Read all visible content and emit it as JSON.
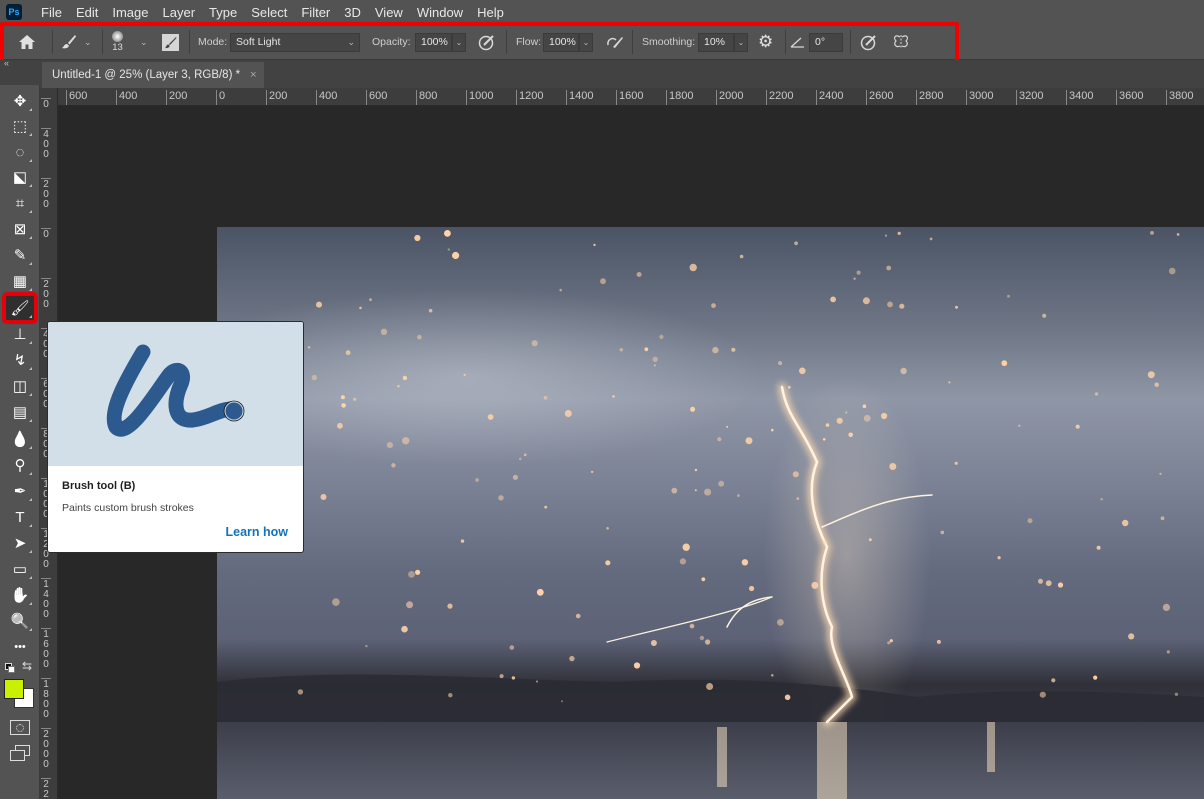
{
  "app": {
    "logo": "Ps"
  },
  "menu": [
    "File",
    "Edit",
    "Image",
    "Layer",
    "Type",
    "Select",
    "Filter",
    "3D",
    "View",
    "Window",
    "Help"
  ],
  "options_bar": {
    "brush_size": "13",
    "mode_label": "Mode:",
    "mode_value": "Soft Light",
    "opacity_label": "Opacity:",
    "opacity_value": "100%",
    "flow_label": "Flow:",
    "flow_value": "100%",
    "smoothing_label": "Smoothing:",
    "smoothing_value": "10%",
    "angle_value": "0°",
    "highlight_color": "#f20000"
  },
  "document_tab": {
    "title": "Untitled-1 @ 25% (Layer 3, RGB/8) *",
    "close": "×"
  },
  "rulers": {
    "horizontal": [
      "600",
      "400",
      "200",
      "0",
      "200",
      "400",
      "600",
      "800",
      "1000",
      "1200",
      "1400",
      "1600",
      "1800",
      "2000",
      "2200",
      "2400",
      "2600",
      "2800",
      "3000",
      "3200",
      "3400",
      "3600",
      "3800"
    ],
    "vertical": [
      "0",
      "400",
      "200",
      "0",
      "200",
      "400",
      "600",
      "800",
      "1000",
      "1200",
      "1400",
      "1600",
      "1800",
      "2000",
      "22"
    ]
  },
  "tools": [
    {
      "name": "move-tool",
      "glyph": "✥"
    },
    {
      "name": "marquee-tool",
      "glyph": "⬚"
    },
    {
      "name": "lasso-tool",
      "glyph": "◌"
    },
    {
      "name": "object-selection-tool",
      "glyph": "⬕"
    },
    {
      "name": "crop-tool",
      "glyph": "⌗"
    },
    {
      "name": "frame-tool",
      "glyph": "⊠"
    },
    {
      "name": "eyedropper-tool",
      "glyph": "✎"
    },
    {
      "name": "healing-brush-tool",
      "glyph": "▦"
    },
    {
      "name": "brush-tool",
      "glyph": "🖌",
      "active": true
    },
    {
      "name": "clone-stamp-tool",
      "glyph": "⊥"
    },
    {
      "name": "history-brush-tool",
      "glyph": "↯"
    },
    {
      "name": "eraser-tool",
      "glyph": "◫"
    },
    {
      "name": "gradient-tool",
      "glyph": "▤"
    },
    {
      "name": "blur-tool",
      "glyph": "💧"
    },
    {
      "name": "dodge-tool",
      "glyph": "⚲"
    },
    {
      "name": "pen-tool",
      "glyph": "✒"
    },
    {
      "name": "type-tool",
      "glyph": "T"
    },
    {
      "name": "path-selection-tool",
      "glyph": "➤"
    },
    {
      "name": "rectangle-tool",
      "glyph": "▭"
    },
    {
      "name": "hand-tool",
      "glyph": "✋"
    },
    {
      "name": "zoom-tool",
      "glyph": "🔍"
    },
    {
      "name": "more-tools",
      "glyph": "•••"
    }
  ],
  "colors": {
    "foreground": "#c8f000",
    "background": "#ffffff"
  },
  "tooltip": {
    "title": "Brush tool (B)",
    "description": "Paints custom brush strokes",
    "link": "Learn how"
  }
}
